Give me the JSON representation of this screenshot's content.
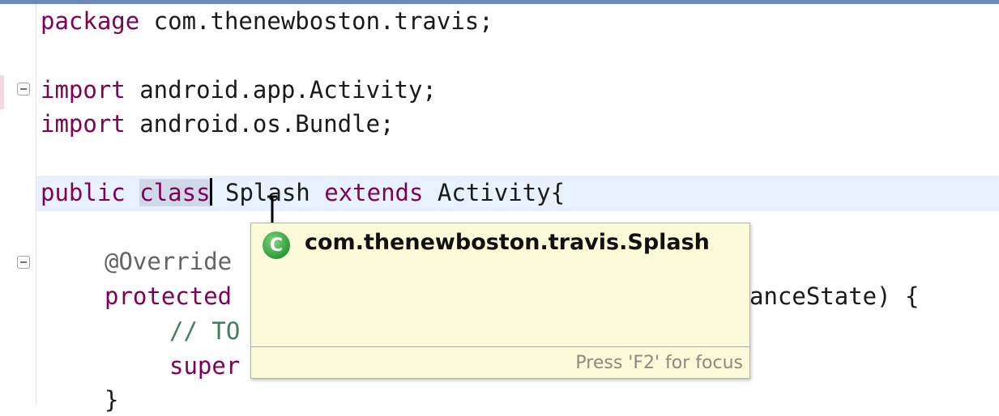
{
  "editor": {
    "lines": [
      {
        "id": "package",
        "tokens": [
          {
            "t": "kw",
            "v": "package"
          },
          {
            "t": "plain",
            "v": " com.thenewboston.travis;"
          }
        ]
      },
      {
        "id": "import-activity",
        "tokens": [
          {
            "t": "kw",
            "v": "import"
          },
          {
            "t": "plain",
            "v": " android.app.Activity;"
          }
        ]
      },
      {
        "id": "import-bundle",
        "tokens": [
          {
            "t": "kw",
            "v": "import"
          },
          {
            "t": "plain",
            "v": " android.os.Bundle;"
          }
        ]
      },
      {
        "id": "class-decl",
        "tokens": [
          {
            "t": "kw",
            "v": "public"
          },
          {
            "t": "plain",
            "v": " "
          },
          {
            "t": "kwsel",
            "v": "class"
          },
          {
            "t": "caret",
            "v": ""
          },
          {
            "t": "plain",
            "v": " Splash "
          },
          {
            "t": "kw",
            "v": "extends"
          },
          {
            "t": "plain",
            "v": " Activity{"
          }
        ]
      },
      {
        "id": "override",
        "tokens": [
          {
            "t": "ann",
            "v": "@Override"
          }
        ]
      },
      {
        "id": "oncreate-start",
        "tokens": [
          {
            "t": "kw",
            "v": "protected"
          }
        ]
      },
      {
        "id": "oncreate-end",
        "tokens": [
          {
            "t": "plain",
            "v": "anceState) {"
          }
        ]
      },
      {
        "id": "todo",
        "tokens": [
          {
            "t": "cmt",
            "v": "// TO"
          }
        ]
      },
      {
        "id": "super",
        "tokens": [
          {
            "t": "kw",
            "v": "super"
          }
        ]
      },
      {
        "id": "closing",
        "tokens": [
          {
            "t": "plain",
            "v": "}"
          }
        ]
      }
    ]
  },
  "hover": {
    "icon": "class-icon",
    "icon_letter": "C",
    "type_name": "com.thenewboston.travis.Splash",
    "footer": "Press 'F2' for focus"
  },
  "colors": {
    "keyword": "#7f0055",
    "annotation": "#646464",
    "comment": "#3f7f5f",
    "current_line": "#e8f2fe",
    "hover_background": "#fbfbd9"
  }
}
